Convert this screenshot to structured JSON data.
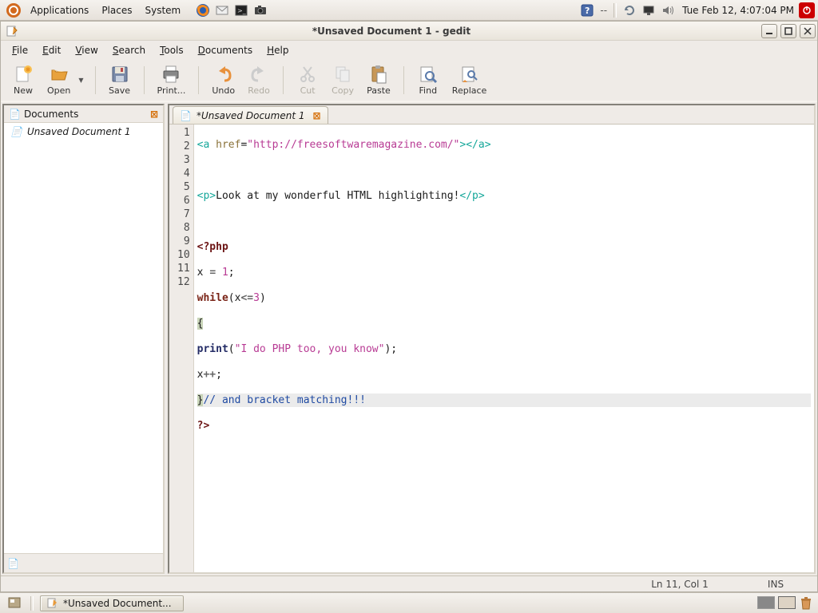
{
  "panel": {
    "menus": [
      "Applications",
      "Places",
      "System"
    ],
    "battery": "--",
    "clock": "Tue Feb 12,  4:07:04 PM"
  },
  "window": {
    "title": "*Unsaved Document 1 - gedit"
  },
  "menubar": {
    "file": "File",
    "edit": "Edit",
    "view": "View",
    "search": "Search",
    "tools": "Tools",
    "documents": "Documents",
    "help": "Help"
  },
  "toolbar": {
    "new": "New",
    "open": "Open",
    "save": "Save",
    "print": "Print...",
    "undo": "Undo",
    "redo": "Redo",
    "cut": "Cut",
    "copy": "Copy",
    "paste": "Paste",
    "find": "Find",
    "replace": "Replace"
  },
  "side_panel": {
    "title": "Documents",
    "items": [
      "Unsaved Document 1"
    ]
  },
  "tab": {
    "title": "*Unsaved Document 1"
  },
  "code": {
    "lines": [
      "1",
      "2",
      "3",
      "4",
      "5",
      "6",
      "7",
      "8",
      "9",
      "10",
      "11",
      "12"
    ],
    "l1_a_open": "<a",
    "l1_href_attr": " href",
    "l1_eq": "=",
    "l1_url": "\"http://freesoftwaremagazine.com/\"",
    "l1_gt": ">",
    "l1_a_close": "</a>",
    "l3_p_open": "<p>",
    "l3_text": "Look at my wonderful HTML highlighting!",
    "l3_p_close": "</p>",
    "l5_php": "<?php",
    "l6_x": "x ",
    "l6_eq": "= ",
    "l6_val": "1",
    "l6_semi": ";",
    "l7_while": "while",
    "l7_open": "(x",
    "l7_op": "<=",
    "l7_num": "3",
    "l7_close": ")",
    "l8_brace": "{",
    "l9_print": "print",
    "l9_open": "(",
    "l9_str": "\"I do PHP too, you know\"",
    "l9_close": ");",
    "l10_x": "x",
    "l10_op": "++",
    "l10_semi": ";",
    "l11_brace": "}",
    "l11_comment": "// and bracket matching!!!",
    "l12_php_close": "?>"
  },
  "statusbar": {
    "pos": "Ln 11, Col 1",
    "mode": "INS"
  },
  "taskbar": {
    "task1": "*Unsaved Document..."
  }
}
